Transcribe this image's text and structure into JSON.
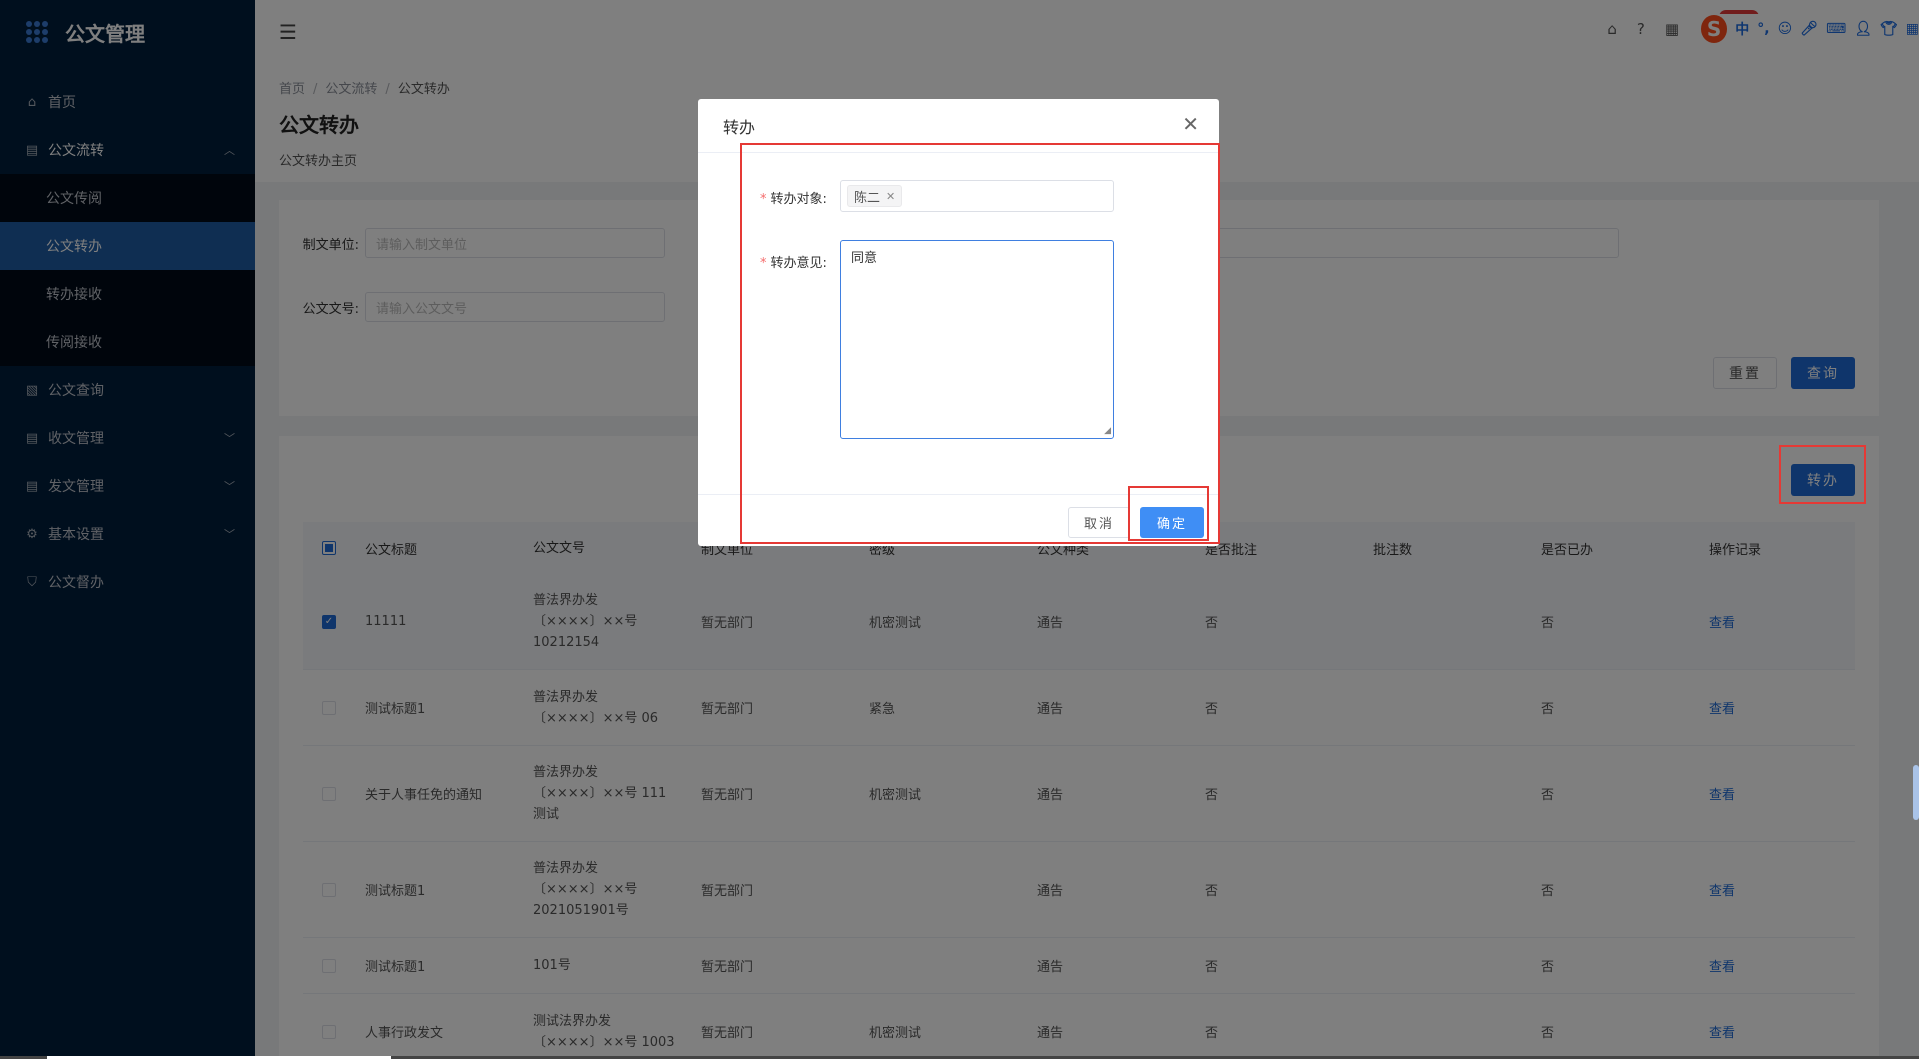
{
  "app": {
    "title": "公文管理"
  },
  "sidebar": {
    "items": [
      {
        "label": "首页",
        "icon": "home-icon"
      },
      {
        "label": "公文流转",
        "icon": "document-icon",
        "expanded": true,
        "children": [
          {
            "label": "公文传阅",
            "active": false
          },
          {
            "label": "公文转办",
            "active": true
          },
          {
            "label": "转办接收",
            "active": false
          },
          {
            "label": "传阅接收",
            "active": false
          }
        ]
      },
      {
        "label": "公文查询",
        "icon": "search-doc-icon"
      },
      {
        "label": "收文管理",
        "icon": "inbox-doc-icon"
      },
      {
        "label": "发文管理",
        "icon": "outbox-doc-icon"
      },
      {
        "label": "基本设置",
        "icon": "gear-icon"
      },
      {
        "label": "公文督办",
        "icon": "shield-icon"
      }
    ]
  },
  "topbar": {
    "ime": {
      "logo": "S",
      "mode": "中"
    }
  },
  "breadcrumb": [
    "首页",
    "公文流转",
    "公文转办"
  ],
  "page": {
    "title": "公文转办",
    "subtitle": "公文转办主页"
  },
  "search": {
    "unit_label": "制文单位:",
    "unit_placeholder": "请输入制文单位",
    "docno_label": "公文文号:",
    "docno_placeholder": "请输入公文文号",
    "reset_label": "重置",
    "query_label": "查询"
  },
  "toolbar": {
    "transfer_label": "转办"
  },
  "table": {
    "headers": [
      "公文标题",
      "公文文号",
      "制文单位",
      "密级",
      "公文种类",
      "是否批注",
      "批注数",
      "是否已办",
      "操作记录"
    ],
    "rows": [
      {
        "checked": true,
        "title": "11111",
        "docno": [
          "普法界办发",
          "〔××××〕××号",
          "10212154"
        ],
        "unit": "暂无部门",
        "secret": "机密测试",
        "kind": "通告",
        "annotated": "否",
        "count": "",
        "done": "否",
        "action": "查看"
      },
      {
        "checked": false,
        "title": "测试标题1",
        "docno": [
          "普法界办发",
          "〔××××〕××号 06"
        ],
        "unit": "暂无部门",
        "secret": "紧急",
        "kind": "通告",
        "annotated": "否",
        "count": "",
        "done": "否",
        "action": "查看"
      },
      {
        "checked": false,
        "title": "关于人事任免的通知",
        "docno": [
          "普法界办发",
          "〔××××〕××号 111",
          "测试"
        ],
        "unit": "暂无部门",
        "secret": "机密测试",
        "kind": "通告",
        "annotated": "否",
        "count": "",
        "done": "否",
        "action": "查看"
      },
      {
        "checked": false,
        "title": "测试标题1",
        "docno": [
          "普法界办发",
          "〔××××〕××号",
          "2021051901号"
        ],
        "unit": "暂无部门",
        "secret": "",
        "kind": "通告",
        "annotated": "否",
        "count": "",
        "done": "否",
        "action": "查看"
      },
      {
        "checked": false,
        "title": "测试标题1",
        "docno": [
          "101号"
        ],
        "unit": "暂无部门",
        "secret": "",
        "kind": "通告",
        "annotated": "否",
        "count": "",
        "done": "否",
        "action": "查看"
      },
      {
        "checked": false,
        "title": "人事行政发文",
        "docno": [
          "测试法界办发",
          "〔××××〕××号 1003"
        ],
        "unit": "暂无部门",
        "secret": "机密测试",
        "kind": "通告",
        "annotated": "否",
        "count": "",
        "done": "否",
        "action": "查看"
      }
    ]
  },
  "dialog": {
    "title": "转办",
    "target_label": "转办对象:",
    "target_tag": "陈二",
    "opinion_label": "转办意见:",
    "opinion_value": "同意",
    "cancel_label": "取消",
    "confirm_label": "确定"
  },
  "colors": {
    "primary": "#1e6bd6",
    "sidebar_bg": "#011e3c",
    "highlight": "#e53935"
  }
}
